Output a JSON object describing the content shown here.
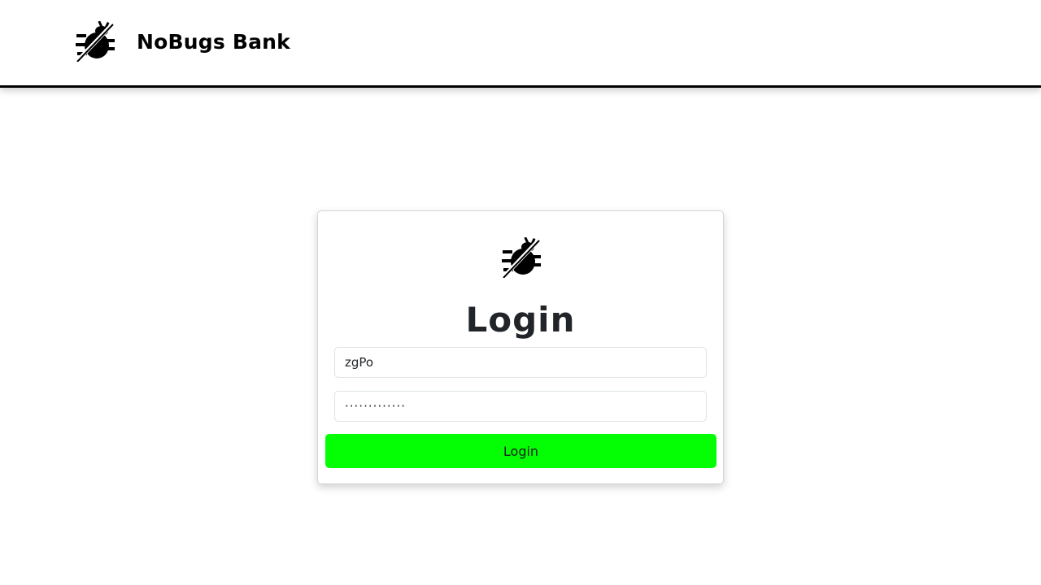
{
  "header": {
    "brand_name": "NoBugs Bank",
    "logo_icon": "no-bug-icon"
  },
  "login_card": {
    "logo_icon": "no-bug-icon",
    "title": "Login",
    "username": {
      "value": "zgPo"
    },
    "password": {
      "value": "·············"
    },
    "submit_label": "Login"
  },
  "colors": {
    "accent": "#04ff04",
    "header_border": "#000000",
    "text": "#212529"
  }
}
